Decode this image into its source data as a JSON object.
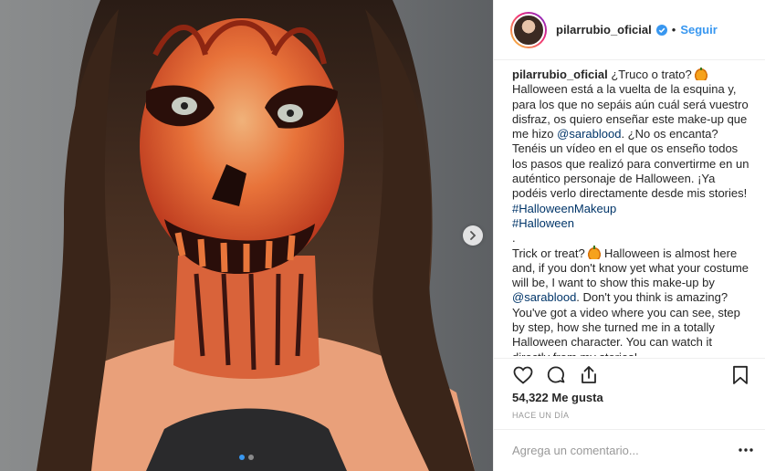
{
  "header": {
    "username": "pilarrubio_oficial",
    "separator": "•",
    "follow_label": "Seguir"
  },
  "caption": {
    "username": "pilarrubio_oficial",
    "es_1": " ¿Truco o trato? ",
    "es_2": " Halloween está a la vuelta de la esquina y, para los que no sepáis aún cuál será vuestro disfraz, os quiero enseñar este make-up que me hizo ",
    "mention_1": "@sarablood",
    "es_3": ". ¿No os encanta? Tenéis un vídeo en el que os enseño todos los pasos que realizó para convertirme en un auténtico personaje de Halloween. ¡Ya podéis verlo directamente desde mis stories! ",
    "hashtag_1": "#HalloweenMakeup",
    "hashtag_2": "#Halloween",
    "period_line": ".",
    "en_1": "Trick or treat? ",
    "en_2": " Halloween is almost here and, if you don't know yet what your costume will be, I want to show this make-up by ",
    "mention_2": "@sarablood",
    "en_3": ". Don't you think is amazing? You've got a video where you can see, step by step, how she turned me in a totally Halloween character. You can watch it directly from my stories!"
  },
  "likes": "54,322 Me gusta",
  "time": "HACE UN DÍA",
  "comment": {
    "placeholder": "Agrega un comentario..."
  },
  "carousel": {
    "count": 2,
    "active": 1
  },
  "icons": {
    "verified": "verified-badge-icon",
    "like": "heart-icon",
    "comment": "comment-icon",
    "share": "share-icon",
    "save": "bookmark-icon",
    "next": "chevron-right-icon",
    "more": "more-options-icon",
    "emoji": "pumpkin-emoji-icon"
  },
  "colors": {
    "accent": "#3897f0",
    "link": "#003569",
    "text": "#262626",
    "muted": "#999999",
    "border": "#efefef"
  }
}
